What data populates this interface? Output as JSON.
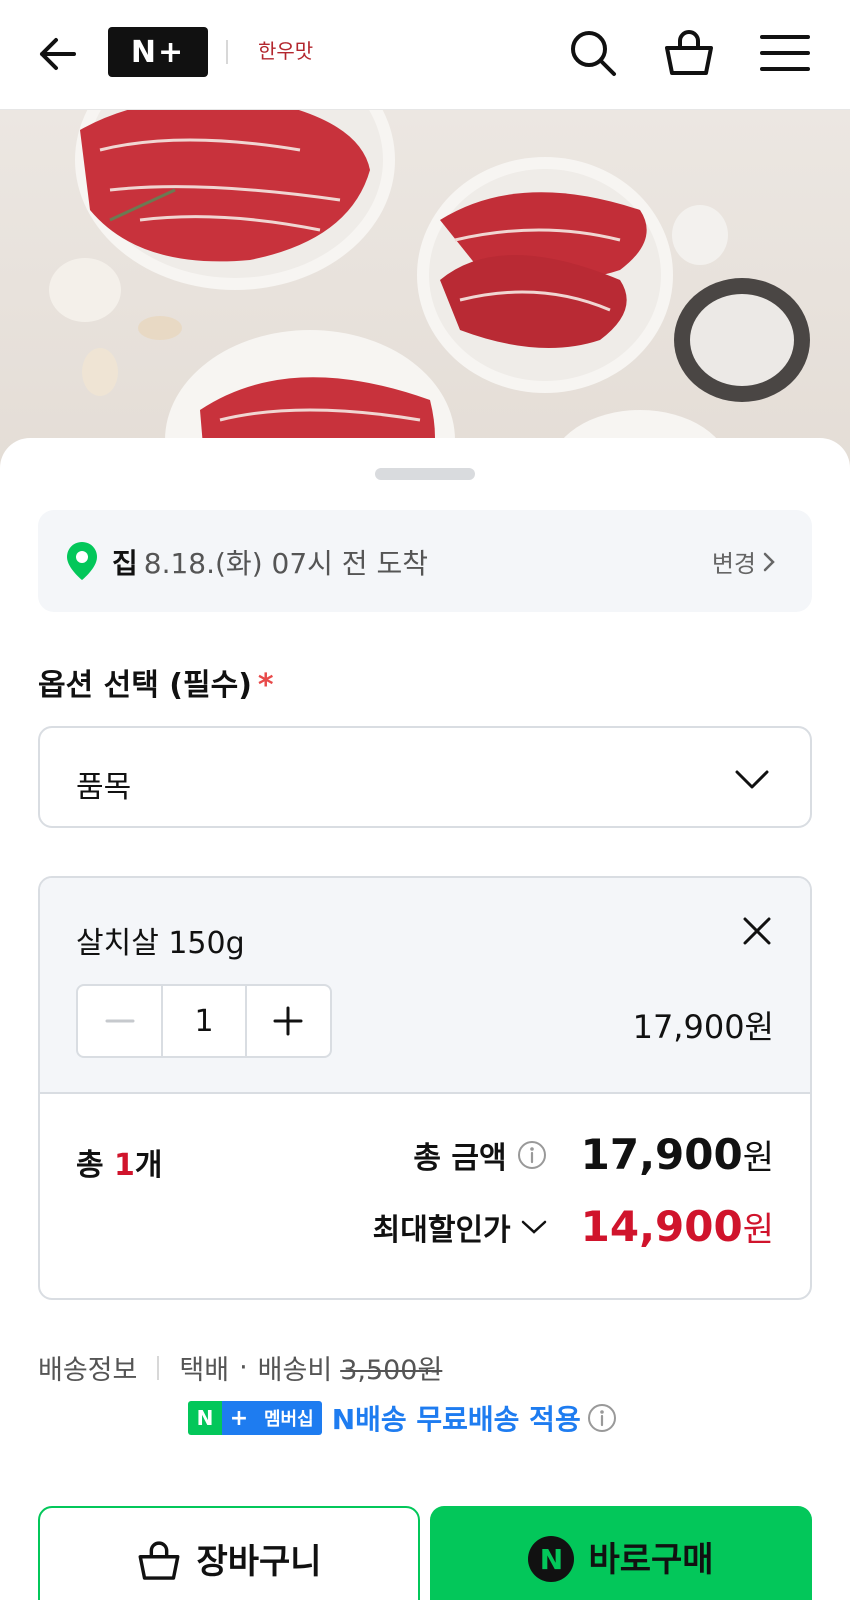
{
  "header": {
    "logo_text": "N+",
    "brand_logo_text": "한우맛"
  },
  "delivery": {
    "place": "집",
    "arrival": "8.18.(화) 07시 전 도착",
    "change_label": "변경"
  },
  "option": {
    "title": "옵션 선택 (필수)",
    "required_mark": "*",
    "select_value": "품목"
  },
  "item": {
    "name": "살치살 150g",
    "quantity": "1",
    "price": "17,900원"
  },
  "totals": {
    "count_prefix": "총 ",
    "count": "1",
    "count_suffix": "개",
    "total_label": "총 금액",
    "total_amount": "17,900",
    "currency": "원",
    "discount_label": "최대할인가",
    "discount_amount": "14,900"
  },
  "shipping": {
    "label": "배송정보",
    "method": "택배",
    "dot": "·",
    "fee_label": "배송비",
    "fee_original": "3,500원",
    "badge_text": "멤버십",
    "free_text": "N배송 무료배송 적용"
  },
  "buttons": {
    "cart": "장바구니",
    "buy": "바로구매",
    "buy_badge": "N"
  },
  "colors": {
    "accent_green": "#03c75a",
    "price_red": "#d0142c",
    "member_blue": "#1e7cf0"
  }
}
